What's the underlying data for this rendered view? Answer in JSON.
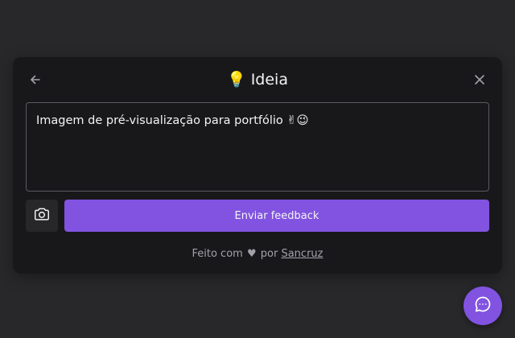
{
  "widget": {
    "title_emoji": "💡",
    "title": "Ideia",
    "back_icon": "arrow-left-icon",
    "close_icon": "close-icon",
    "textarea_value": "Imagem de pré-visualização para portfólio ✌😉",
    "screenshot_icon": "camera-icon",
    "submit_label": "Enviar feedback",
    "footer": {
      "prefix": "Feito com",
      "heart": "♥",
      "by": "por",
      "link": "Sancruz"
    }
  },
  "fab": {
    "icon": "chat-bubble-icon"
  },
  "colors": {
    "background": "#28282b",
    "card": "#18181b",
    "accent": "#8153e0",
    "text": "#f4f4f5",
    "muted": "#a1a1aa"
  }
}
